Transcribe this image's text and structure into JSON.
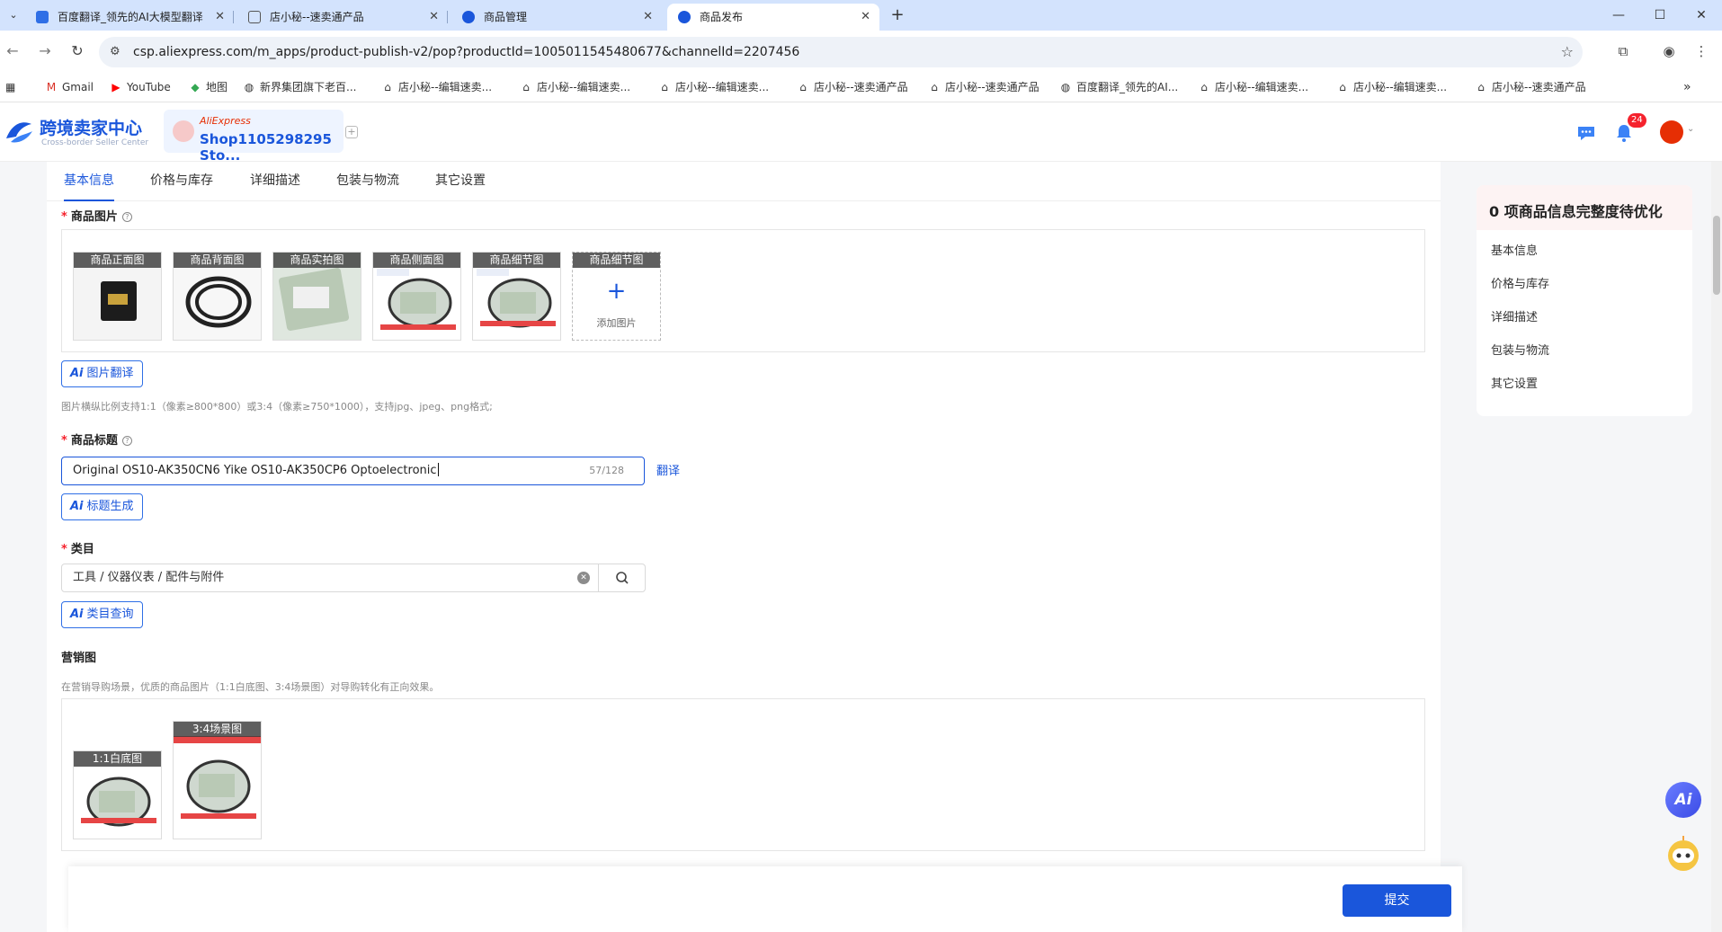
{
  "browser": {
    "tabs": [
      {
        "title": "百度翻译_领先的AI大模型翻译",
        "active": false
      },
      {
        "title": "店小秘--速卖通产品",
        "active": false
      },
      {
        "title": "商品管理",
        "active": false
      },
      {
        "title": "商品发布",
        "active": true
      }
    ],
    "url": "csp.aliexpress.com/m_apps/product-publish-v2/pop?productId=1005011545480677&channelId=2207456",
    "bookmarks": [
      "Gmail",
      "YouTube",
      "地图",
      "新界集团旗下老百...",
      "店小秘--编辑速卖...",
      "店小秘--编辑速卖...",
      "店小秘--编辑速卖...",
      "店小秘--速卖通产品",
      "店小秘--速卖通产品",
      "百度翻译_领先的AI...",
      "店小秘--编辑速卖...",
      "店小秘--编辑速卖...",
      "店小秘--速卖通产品"
    ]
  },
  "header": {
    "logo_title": "跨境卖家中心",
    "logo_subtitle": "Cross-border Seller Center",
    "shop_brand": "AliExpress",
    "shop_name": "Shop1105298295 Sto...",
    "notification_count": "24"
  },
  "tabs": [
    "基本信息",
    "价格与库存",
    "详细描述",
    "包装与物流",
    "其它设置"
  ],
  "product_images": {
    "label": "商品图片",
    "slots": [
      "商品正面图",
      "商品背面图",
      "商品实拍图",
      "商品侧面图",
      "商品细节图",
      "商品细节图"
    ],
    "add_label": "添加图片",
    "translate_button": "图片翻译",
    "hint": "图片横纵比例支持1:1（像素≥800*800）或3:4（像素≥750*1000），支持jpg、jpeg、png格式;"
  },
  "product_title": {
    "label": "商品标题",
    "value": "Original OS10-AK350CN6 Yike OS10-AK350CP6 Optoelectronic",
    "count": "57/128",
    "translate_link": "翻译",
    "generate_button": "标题生成"
  },
  "category": {
    "label": "类目",
    "value": "工具 / 仪器仪表 / 配件与附件",
    "query_button": "类目查询"
  },
  "marketing": {
    "label": "营销图",
    "hint": "在营销导购场景，优质的商品图片（1:1白底图、3:4场景图）对导购转化有正向效果。",
    "slots": [
      "1:1白底图",
      "3:4场景图"
    ]
  },
  "panel": {
    "title": "0 项商品信息完整度待优化",
    "items": [
      "基本信息",
      "价格与库存",
      "详细描述",
      "包装与物流",
      "其它设置"
    ]
  },
  "fab_ai": "Ai",
  "submit": "提交",
  "colors": {
    "primary": "#1a56db",
    "danger": "#f5222d",
    "brand": "#e62e04"
  }
}
